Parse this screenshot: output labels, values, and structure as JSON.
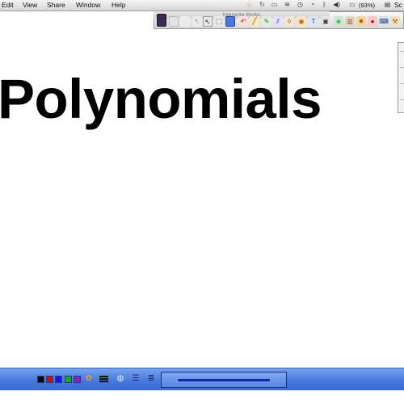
{
  "menubar": {
    "items": [
      "Edit",
      "View",
      "Share",
      "Window",
      "Help"
    ],
    "battery": "(93%)",
    "user_partial": "Sc"
  },
  "toolbar": {
    "window_title": "Interwrite Works"
  },
  "slide": {
    "title": "Polynomials"
  },
  "palette": {
    "colors": [
      "#0a0a0a",
      "#c0181c",
      "#1a1adf",
      "#22a22a",
      "#8b25b8"
    ]
  }
}
